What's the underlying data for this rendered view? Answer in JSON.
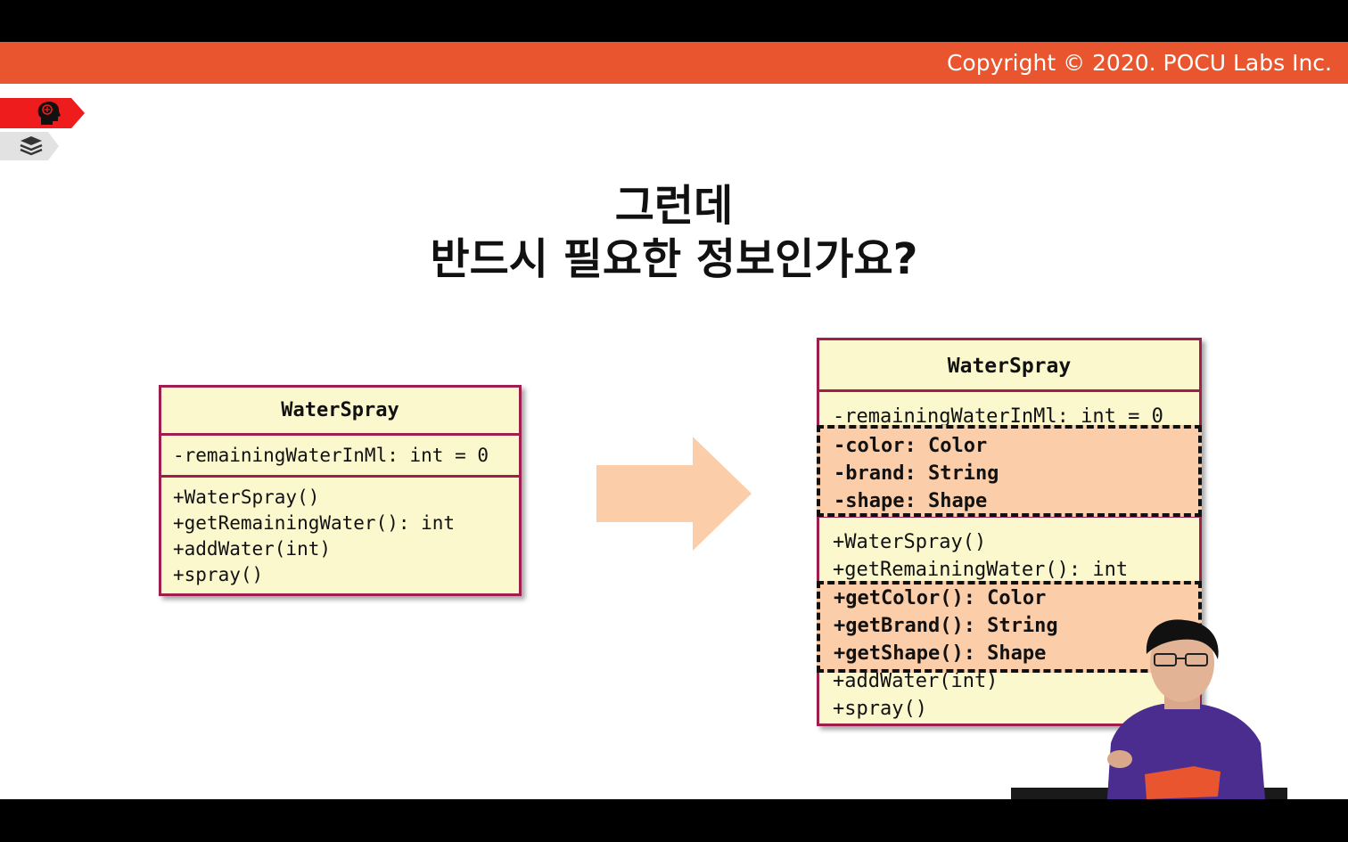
{
  "header": {
    "copyright": "Copyright © 2020. POCU Labs Inc."
  },
  "side_tags": {
    "top_icon": "brain-head-icon",
    "bottom_icon": "book-stack-icon",
    "colors": {
      "red": "#ee1c1c",
      "gray": "#e2e2e2"
    }
  },
  "title": {
    "line1": "그런데",
    "line2": "반드시 필요한 정보인가요?"
  },
  "left_class": {
    "name": "WaterSpray",
    "attributes": [
      "-remainingWaterInMl: int = 0"
    ],
    "operations": [
      "+WaterSpray()",
      "+getRemainingWater(): int",
      "+addWater(int)",
      "+spray()"
    ]
  },
  "right_class": {
    "name": "WaterSpray",
    "attributes": [
      "-remainingWaterInMl: int = 0"
    ],
    "added_attributes": [
      "-color: Color",
      "-brand: String",
      "-shape: Shape"
    ],
    "operations_before": [
      "+WaterSpray()",
      "+getRemainingWater(): int"
    ],
    "added_operations": [
      "+getColor(): Color",
      "+getBrand(): String",
      "+getShape(): Shape"
    ],
    "operations_after": [
      "+addWater(int)",
      "+spray()"
    ]
  },
  "colors": {
    "header": "#e8552e",
    "uml_fill": "#fcf8cd",
    "uml_border": "#9e1f4e",
    "highlight": "#fbcda8",
    "arrow": "#fbcda8"
  }
}
